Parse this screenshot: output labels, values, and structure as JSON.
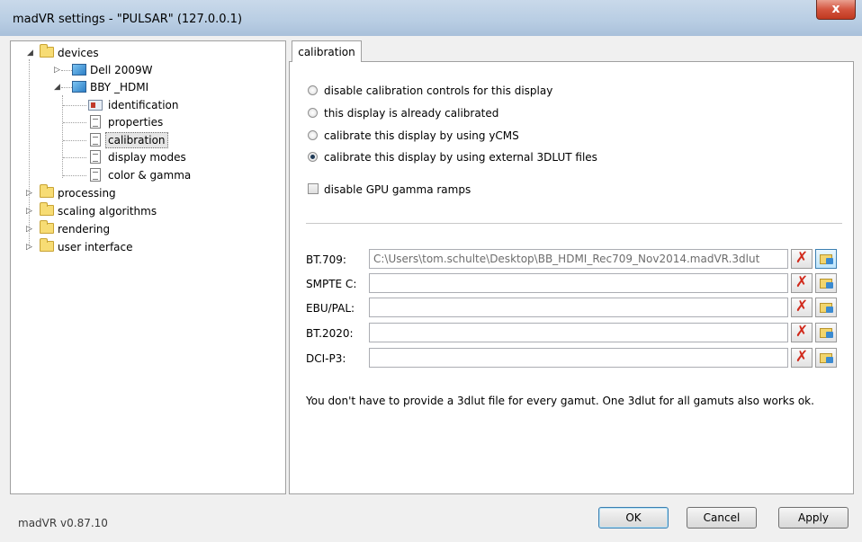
{
  "window": {
    "title": "madVR settings - \"PULSAR\" (127.0.0.1)",
    "close_label": "x"
  },
  "tree": {
    "devices": "devices",
    "dell": "Dell 2009W",
    "bby": "BBY _HDMI",
    "identification": "identification",
    "properties": "properties",
    "calibration": "calibration",
    "display_modes": "display modes",
    "color_gamma": "color & gamma",
    "processing": "processing",
    "scaling": "scaling algorithms",
    "rendering": "rendering",
    "user_interface": "user interface"
  },
  "tab": {
    "label": "calibration"
  },
  "calibration": {
    "options": [
      {
        "label": "disable calibration controls for this display",
        "selected": false
      },
      {
        "label": "this display is already calibrated",
        "selected": false
      },
      {
        "label": "calibrate this display by using yCMS",
        "selected": false
      },
      {
        "label": "calibrate this display by using external 3DLUT files",
        "selected": true
      }
    ],
    "gpu_gamma_label": "disable GPU gamma ramps",
    "gpu_gamma_checked": false,
    "luts": [
      {
        "label": "BT.709:",
        "value": "C:\\Users\\tom.schulte\\Desktop\\BB_HDMI_Rec709_Nov2014.madVR.3dlut"
      },
      {
        "label": "SMPTE C:",
        "value": ""
      },
      {
        "label": "EBU/PAL:",
        "value": ""
      },
      {
        "label": "BT.2020:",
        "value": ""
      },
      {
        "label": "DCI-P3:",
        "value": ""
      }
    ],
    "note": "You don't have to provide a 3dlut file for every gamut. One 3dlut for all gamuts also works ok."
  },
  "footer": {
    "version": "madVR v0.87.10",
    "ok": "OK",
    "cancel": "Cancel",
    "apply": "Apply"
  },
  "colors": {
    "accent": "#3c7fb1",
    "close_red": "#c0391f",
    "remove_red": "#d12a1c"
  }
}
